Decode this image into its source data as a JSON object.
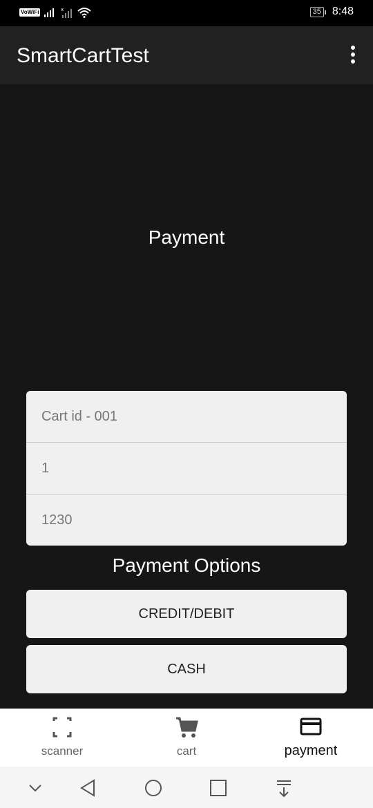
{
  "status_bar": {
    "network_badge": "VoWiFi",
    "battery": "35",
    "time": "8:48"
  },
  "app_bar": {
    "title": "SmartCartTest",
    "menu_icon": "more-vert-icon"
  },
  "page": {
    "title": "Payment"
  },
  "fields": {
    "cart_id": "Cart id - 001",
    "field_two": "1",
    "field_three": "1230"
  },
  "payment_options": {
    "title": "Payment Options",
    "credit_debit": "CREDIT/DEBIT",
    "cash": "CASH"
  },
  "bottom_nav": {
    "items": [
      {
        "label": "scanner",
        "icon": "scanner-icon",
        "active": false
      },
      {
        "label": "cart",
        "icon": "cart-icon",
        "active": false
      },
      {
        "label": "payment",
        "icon": "credit-card-icon",
        "active": true
      }
    ]
  },
  "system_nav": {
    "icons": [
      "hide-keyboard-icon",
      "back-icon",
      "home-icon",
      "recents-icon",
      "notification-pull-icon"
    ]
  }
}
